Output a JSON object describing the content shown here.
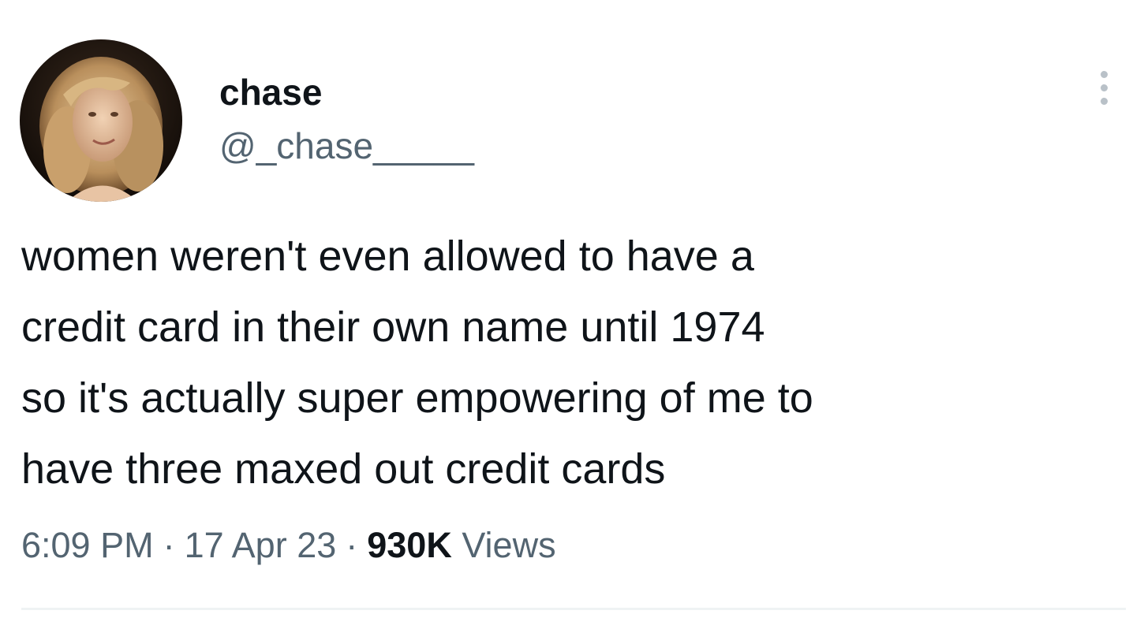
{
  "author": {
    "display_name": "chase",
    "handle": "@_chase_____",
    "avatar_icon": "profile-photo-avatar"
  },
  "more_menu": {
    "icon": "more-vertical-icon"
  },
  "tweet": {
    "lines": [
      "women weren't even allowed to have a",
      "credit card in their own name until 1974",
      "so it's actually super empowering of me to",
      "have three maxed out credit cards"
    ]
  },
  "meta": {
    "time": "6:09 PM",
    "separator": "·",
    "date": "17 Apr 23",
    "views_count": "930K",
    "views_label": "Views"
  },
  "colors": {
    "primary_text": "#0f1419",
    "secondary_text": "#536471",
    "divider": "#eff3f4"
  }
}
